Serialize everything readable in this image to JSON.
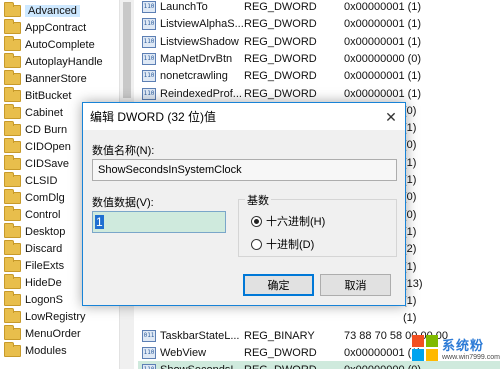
{
  "tree": {
    "items": [
      {
        "label": "Advanced",
        "selected": true
      },
      {
        "label": "AppContract"
      },
      {
        "label": "AutoComplete"
      },
      {
        "label": "AutoplayHandle"
      },
      {
        "label": "BannerStore"
      },
      {
        "label": "BitBucket"
      },
      {
        "label": "Cabinet"
      },
      {
        "label": "CD Burn"
      },
      {
        "label": "CIDOpen"
      },
      {
        "label": "CIDSave"
      },
      {
        "label": "CLSID"
      },
      {
        "label": "ComDlg"
      },
      {
        "label": "Control"
      },
      {
        "label": "Desktop"
      },
      {
        "label": "Discard"
      },
      {
        "label": "FileExts"
      },
      {
        "label": "HideDe"
      },
      {
        "label": "LogonS"
      },
      {
        "label": "LowRegistry"
      },
      {
        "label": "MenuOrder"
      },
      {
        "label": "Modules"
      }
    ]
  },
  "values": {
    "rows": [
      {
        "name": "LaunchTo",
        "type": "REG_DWORD",
        "data": "0x00000001 (1)"
      },
      {
        "name": "ListviewAlphaS...",
        "type": "REG_DWORD",
        "data": "0x00000001 (1)"
      },
      {
        "name": "ListviewShadow",
        "type": "REG_DWORD",
        "data": "0x00000001 (1)"
      },
      {
        "name": "MapNetDrvBtn",
        "type": "REG_DWORD",
        "data": "0x00000000 (0)"
      },
      {
        "name": "nonetcrawling",
        "type": "REG_DWORD",
        "data": "0x00000001 (1)"
      },
      {
        "name": "ReindexedProf...",
        "type": "REG_DWORD",
        "data": "0x00000001 (1)"
      },
      {
        "name": "",
        "type": "",
        "data": "(0)"
      },
      {
        "name": "",
        "type": "",
        "data": "(1)"
      },
      {
        "name": "",
        "type": "",
        "data": "(0)"
      },
      {
        "name": "",
        "type": "",
        "data": "(1)"
      },
      {
        "name": "",
        "type": "",
        "data": "(1)"
      },
      {
        "name": "",
        "type": "",
        "data": "(0)"
      },
      {
        "name": "",
        "type": "",
        "data": "(0)"
      },
      {
        "name": "",
        "type": "",
        "data": "(1)"
      },
      {
        "name": "",
        "type": "",
        "data": "(2)"
      },
      {
        "name": "",
        "type": "",
        "data": "(1)"
      },
      {
        "name": "",
        "type": "",
        "data": "(13)"
      },
      {
        "name": "",
        "type": "",
        "data": "(1)"
      },
      {
        "name": "",
        "type": "",
        "data": "(1)"
      },
      {
        "name": "TaskbarStateL...",
        "type": "REG_BINARY",
        "data": "73 88 70 58 00 00 00"
      },
      {
        "name": "WebView",
        "type": "REG_DWORD",
        "data": "0x00000001 (1)"
      },
      {
        "name": "ShowSecondsI...",
        "type": "REG_DWORD",
        "data": "0x00000000 (0)"
      }
    ],
    "highlight_color": "#cfeadd"
  },
  "dialog": {
    "title": "编辑 DWORD (32 位)值",
    "close_glyph": "✕",
    "name_label": "数值名称(N):",
    "name_value": "ShowSecondsInSystemClock",
    "data_label": "数值数据(V):",
    "data_value": "1",
    "base_label": "基数",
    "hex_label": "十六进制(H)",
    "dec_label": "十进制(D)",
    "selected_base": "hex",
    "ok_label": "确定",
    "cancel_label": "取消",
    "accent": "#0078d7"
  },
  "watermark": {
    "main": "系统粉",
    "url": "www.win7999.com",
    "logo_colors": [
      "#f25022",
      "#7fba00",
      "#00a4ef",
      "#ffb900"
    ]
  }
}
